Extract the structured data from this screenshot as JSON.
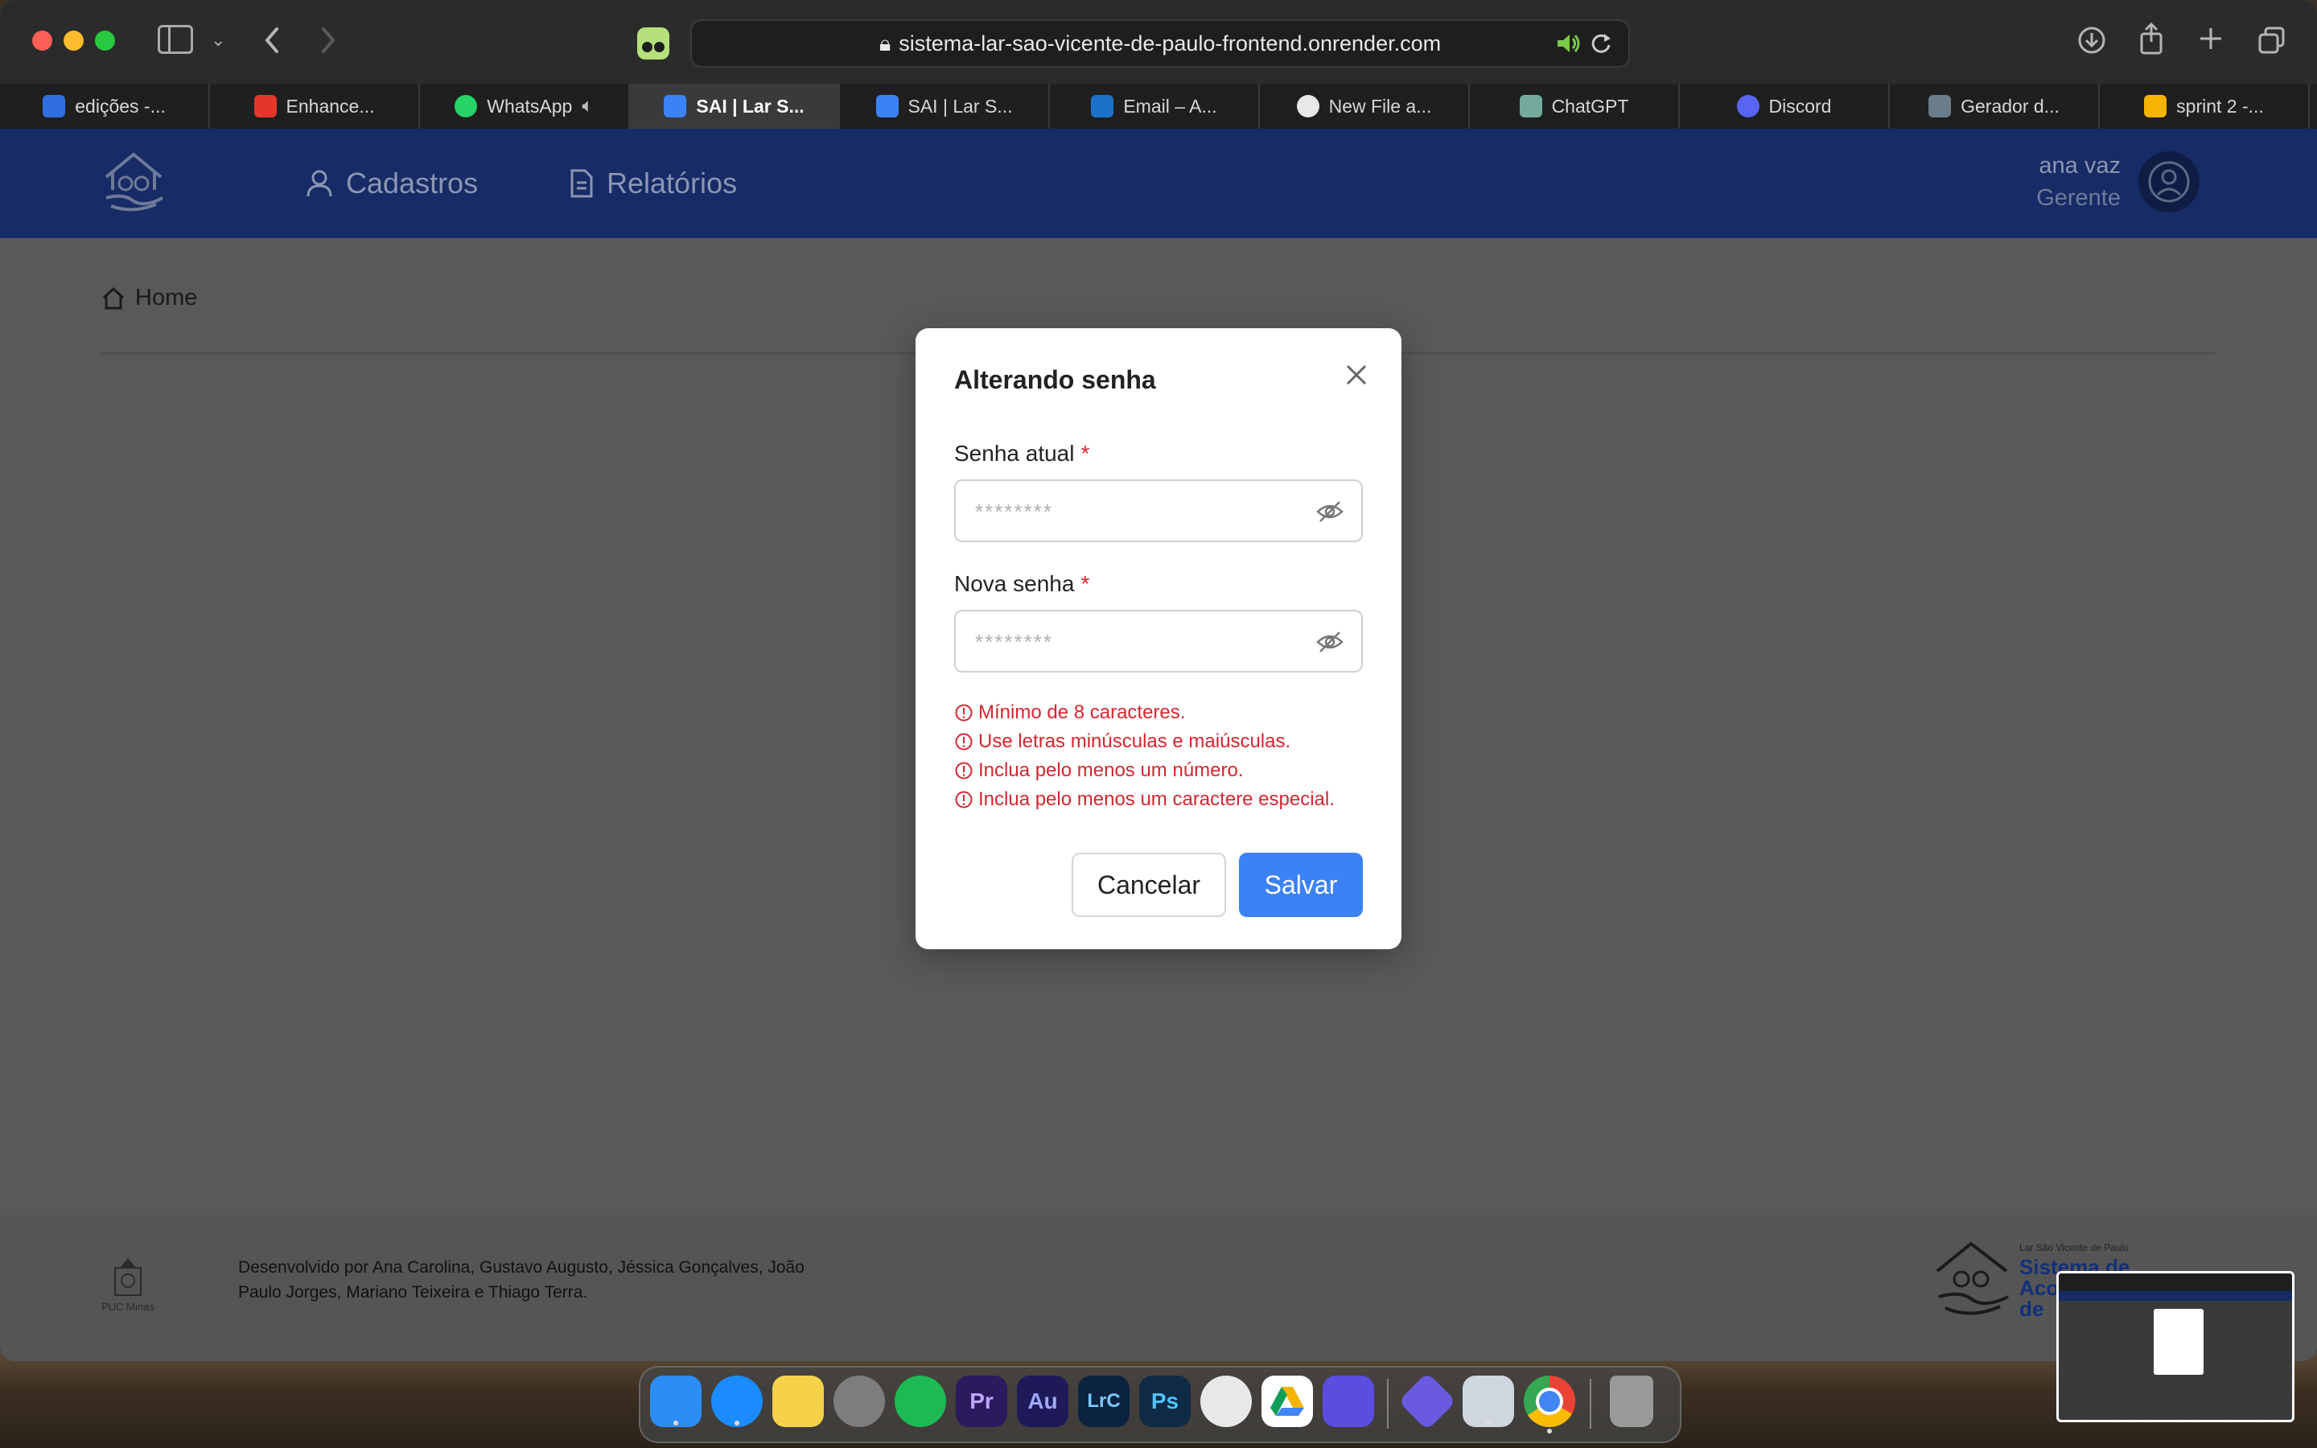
{
  "browser": {
    "url": "sistema-lar-sao-vicente-de-paulo-frontend.onrender.com",
    "tabs": [
      {
        "label": "edições -...",
        "icon": "trello-icon",
        "color": "#2f6fe0",
        "active": false
      },
      {
        "label": "Enhance...",
        "icon": "adobe-icon",
        "color": "#e3372e",
        "active": false
      },
      {
        "label": "WhatsApp",
        "icon": "whatsapp-icon",
        "color": "#25d366",
        "active": false,
        "audio": true
      },
      {
        "label": "SAI | Lar S...",
        "icon": "sai-icon",
        "color": "#3b82f6",
        "active": true
      },
      {
        "label": "SAI | Lar S...",
        "icon": "sai-icon",
        "color": "#3b82f6",
        "active": false
      },
      {
        "label": "Email – A...",
        "icon": "outlook-icon",
        "color": "#1a73c8",
        "active": false
      },
      {
        "label": "New File a...",
        "icon": "github-icon",
        "color": "#e8e8e8",
        "active": false
      },
      {
        "label": "ChatGPT",
        "icon": "chatgpt-icon",
        "color": "#74aa9c",
        "active": false
      },
      {
        "label": "Discord",
        "icon": "discord-icon",
        "color": "#5865f2",
        "active": false
      },
      {
        "label": "Gerador d...",
        "icon": "generator-icon",
        "color": "#6b7c8a",
        "active": false
      },
      {
        "label": "sprint 2 -...",
        "icon": "google-drive-icon",
        "color": "#f4b400",
        "active": false
      }
    ]
  },
  "header": {
    "nav": {
      "cadastros": "Cadastros",
      "relatorios": "Relatórios"
    },
    "user": {
      "name": "ana vaz",
      "role": "Gerente"
    }
  },
  "breadcrumb": {
    "home": "Home"
  },
  "modal": {
    "title": "Alterando senha",
    "current_password": {
      "label": "Senha atual",
      "required_mark": "*",
      "placeholder": "********"
    },
    "new_password": {
      "label": "Nova senha",
      "required_mark": "*",
      "placeholder": "********"
    },
    "rules": [
      "Mínimo de 8 caracteres.",
      "Use letras minúsculas e maiúsculas.",
      "Inclua pelo menos um número.",
      "Inclua pelo menos um caractere especial."
    ],
    "cancel_label": "Cancelar",
    "save_label": "Salvar"
  },
  "footer": {
    "credits": "Desenvolvido por Ana Carolina, Gustavo Augusto, Jéssica Gonçalves, João Paulo Jorges, Mariano Teixeira e Thiago Terra.",
    "puc_label": "PUC Minas",
    "brand_small": "Lar São Vicente de Paulo",
    "brand_line1": "Sistema de",
    "brand_line2": "Aco",
    "brand_line3": "de"
  },
  "dock": {
    "apps": [
      {
        "name": "finder",
        "label": "",
        "color": "#2c8ef4"
      },
      {
        "name": "safari",
        "label": "",
        "color": "#1a8cff"
      },
      {
        "name": "notes",
        "label": "",
        "color": "#f5d24a"
      },
      {
        "name": "settings",
        "label": "",
        "color": "#7d7d7d"
      },
      {
        "name": "spotify",
        "label": "",
        "color": "#1db954"
      },
      {
        "name": "premiere",
        "label": "Pr",
        "color": "#2a1a5e"
      },
      {
        "name": "audition",
        "label": "Au",
        "color": "#1e1a5a"
      },
      {
        "name": "lightroom-classic",
        "label": "LrC",
        "color": "#0c2340"
      },
      {
        "name": "photoshop",
        "label": "Ps",
        "color": "#0f2a44"
      },
      {
        "name": "davinci",
        "label": "",
        "color": "#e8e8e8"
      },
      {
        "name": "google-drive",
        "label": "",
        "color": "#ffffff"
      },
      {
        "name": "proxyman",
        "label": "",
        "color": "#5a4de0"
      },
      {
        "name": "infuse",
        "label": "",
        "color": "#6a5ae0"
      },
      {
        "name": "preview",
        "label": "",
        "color": "#cfd6e0"
      },
      {
        "name": "chrome",
        "label": "",
        "color": "#ffffff"
      },
      {
        "name": "trash",
        "label": "",
        "color": "#9a9a9a"
      }
    ]
  }
}
